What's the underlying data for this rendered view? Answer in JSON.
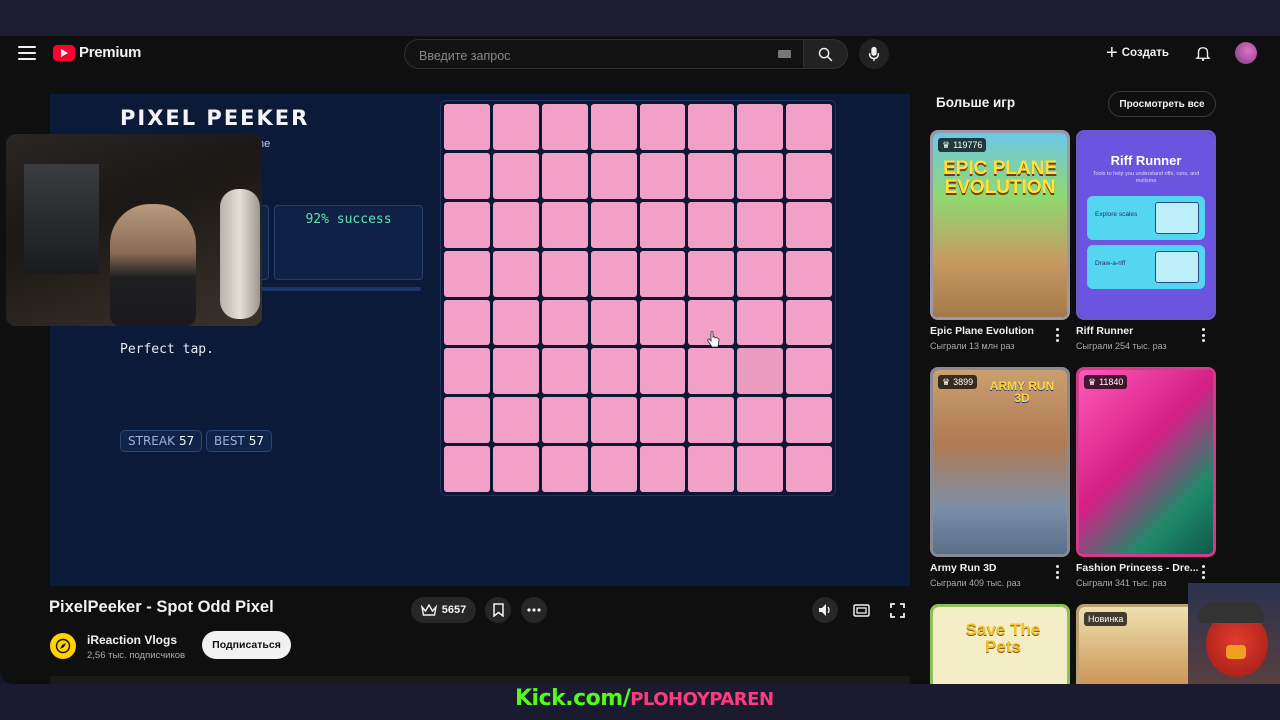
{
  "header": {
    "logo_text": "Premium",
    "search_placeholder": "Введите запрос",
    "create_label": "Создать"
  },
  "game": {
    "title": "PIXEL PEEKER",
    "subtitle_fragment": "ne",
    "success_text": "92% success",
    "feedback": "Perfect tap.",
    "streak_label": "STREAK",
    "streak_value": "57",
    "best_label": "BEST",
    "best_value": "57",
    "grid": {
      "rows": 8,
      "cols": 8,
      "odd_cell": {
        "row": 6,
        "col": 7
      }
    },
    "colors": {
      "cell": "#f1a1c7",
      "odd_cell": "#eb9dc1",
      "success": "#5fe3b0",
      "background": "#0c1a3a"
    }
  },
  "video": {
    "title": "PixelPeeker - Spot Odd Pixel",
    "likes": "5657",
    "channel_name": "iReaction Vlogs",
    "channel_subs": "2,56 тыс. подписчиков",
    "subscribe_label": "Подписаться"
  },
  "sidebar": {
    "title": "Больше игр",
    "view_all_label": "Просмотреть все",
    "cards": [
      {
        "title": "Epic Plane Evolution",
        "plays": "Сыграли 13 млн раз",
        "badge": "119776",
        "art": "EPIC PLANE EVOLUTION"
      },
      {
        "title": "Riff Runner",
        "plays": "Сыграли 254 тыс. раз",
        "art_title": "Riff Runner",
        "art_sub": "Tools to help you understand riffs, runs, and melisma",
        "box1": "Explore scales",
        "box2": "Draw-a-riff"
      },
      {
        "title": "Army Run 3D",
        "plays": "Сыграли 409 тыс. раз",
        "badge": "3899",
        "art": "ARMY RUN 3D"
      },
      {
        "title": "Fashion Princess - Dre...",
        "plays": "Сыграли 341 тыс. раз",
        "badge": "11840"
      },
      {
        "art": "Save The Pets"
      },
      {
        "badge": "Новинка"
      }
    ]
  },
  "overlay": {
    "kick_domain": "Kick.com/",
    "kick_user": "PLOHOYPAREN"
  }
}
